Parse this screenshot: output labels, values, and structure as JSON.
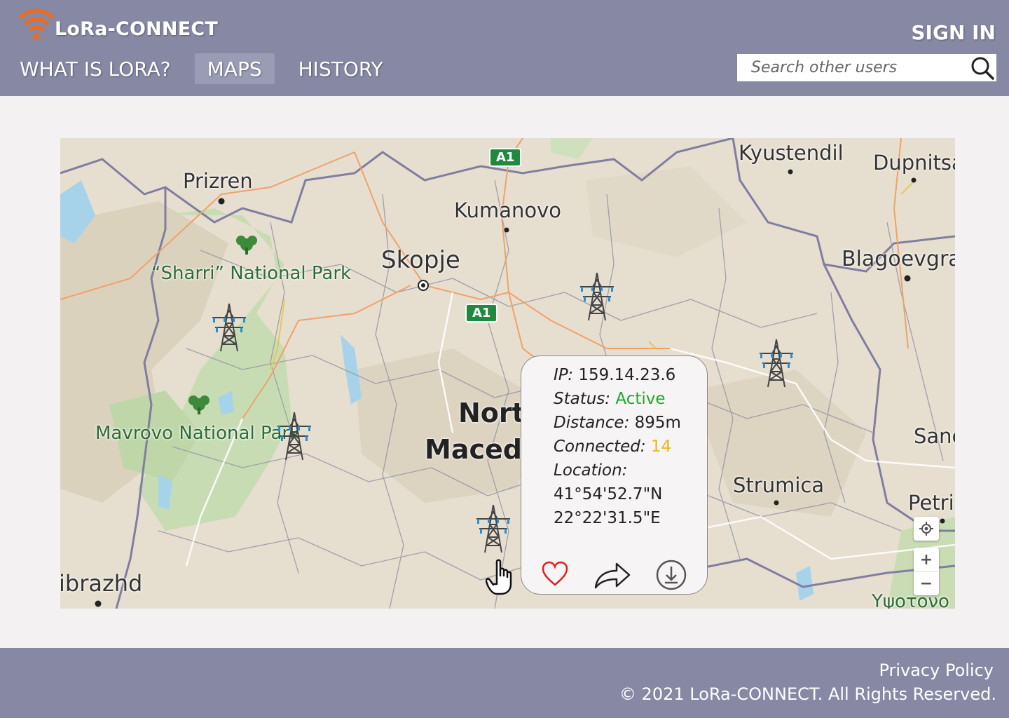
{
  "app": {
    "name": "LoRa-CONNECT",
    "brand_color": "#f06a1e",
    "header_color": "#8788a4"
  },
  "nav": {
    "items": [
      {
        "label": "WHAT IS LORA?",
        "active": false
      },
      {
        "label": "MAPS",
        "active": true
      },
      {
        "label": "HISTORY",
        "active": false
      }
    ]
  },
  "header": {
    "signin_label": "SIGN IN",
    "search_placeholder": "Search other users"
  },
  "map": {
    "places": {
      "prizren": "Prizren",
      "kumanovo": "Kumanovo",
      "kyustendil": "Kyustendil",
      "dupnitsa": "Dupnitsa",
      "skopje": "Skopje",
      "blagoevgrad": "Blagoevgra",
      "sharri": "“Sharri” National Park",
      "mavrovo": "Mavrovo National Park",
      "north": "Nort",
      "macedonia": "Macedo",
      "strumica": "Strumica",
      "sand": "Sanc",
      "petri": "Petri",
      "librazhd": "ibrazhd",
      "ypsoton": "Υψοτονο"
    },
    "road_badge": "A1",
    "towers": 6,
    "controls": {
      "zoom_in": "+",
      "zoom_out": "−"
    }
  },
  "popup": {
    "ip_label": "IP:",
    "ip_value": "159.14.23.6",
    "status_label": "Status:",
    "status_value": "Active",
    "distance_label": "Distance:",
    "distance_value": "895m",
    "connected_label": "Connected:",
    "connected_value": "14",
    "location_label": "Location:",
    "lat": "41°54'52.7\"N",
    "lon": "22°22'31.5\"E",
    "status_color": "#22a52a",
    "connected_color": "#e9b81e"
  },
  "footer": {
    "privacy": "Privacy Policy",
    "copyright": "© 2021 LoRa-CONNECT. All Rights Reserved."
  }
}
